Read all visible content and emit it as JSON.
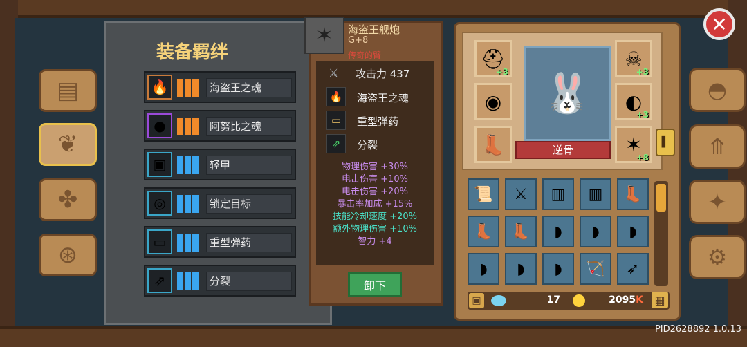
{
  "bonds": {
    "title": "装备羁绊",
    "rows": [
      {
        "name": "海盗王之魂",
        "icon": "flame-icon",
        "frame_color": "#c87a3a",
        "bar_color": "#f08a2a",
        "icon_char": "🔥"
      },
      {
        "name": "阿努比之魂",
        "icon": "fire-orb-icon",
        "frame_color": "#9a4ad8",
        "bar_color": "#f08a2a",
        "icon_char": "●"
      },
      {
        "name": "轻甲",
        "icon": "armor-icon",
        "frame_color": "#3aa6c8",
        "bar_color": "#3aa6f0",
        "icon_char": "▣"
      },
      {
        "name": "锁定目标",
        "icon": "target-icon",
        "frame_color": "#3aa6c8",
        "bar_color": "#3aa6f0",
        "icon_char": "◎"
      },
      {
        "name": "重型弹药",
        "icon": "ammo-icon",
        "frame_color": "#3aa6c8",
        "bar_color": "#3aa6f0",
        "icon_char": "▭"
      },
      {
        "name": "分裂",
        "icon": "split-arrows-icon",
        "frame_color": "#3aa6c8",
        "bar_color": "#3aa6f0",
        "icon_char": "⇗"
      }
    ]
  },
  "item": {
    "name": "海盗王舰炮",
    "level": "G+8",
    "quality": "传奇的臂",
    "attack": "攻击力 437",
    "skills": [
      {
        "icon": "flame-icon",
        "label": "海盗王之魂",
        "icon_char": "🔥",
        "color": "#e04a3a"
      },
      {
        "icon": "ammo-icon",
        "label": "重型弹药",
        "icon_char": "▭",
        "color": "#d8b060"
      },
      {
        "icon": "split-arrows-icon",
        "label": "分裂",
        "icon_char": "⇗",
        "color": "#4ad06a"
      }
    ],
    "stats": [
      {
        "text": "物理伤害 +30%",
        "color": "#c58ae8"
      },
      {
        "text": "电击伤害 +10%",
        "color": "#c58ae8"
      },
      {
        "text": "电击伤害 +20%",
        "color": "#c58ae8"
      },
      {
        "text": "暴击率加成 +15%",
        "color": "#c58ae8"
      },
      {
        "text": "技能冷却速度 +20%",
        "color": "#4ae0c8"
      },
      {
        "text": "额外物理伤害 +10%",
        "color": "#4ae0c8"
      },
      {
        "text": "智力 +4",
        "color": "#c58ae8"
      }
    ],
    "unequip_label": "卸下"
  },
  "character": {
    "name": "逆骨",
    "equip_slots": [
      {
        "name": "helmet-slot",
        "plus": "+3",
        "icon_char": "⛑"
      },
      {
        "name": "ring-slot",
        "plus": "",
        "icon_char": "◉"
      },
      {
        "name": "boots-slot",
        "plus": "",
        "icon_char": "👢"
      },
      {
        "name": "skull-slot",
        "plus": "+3",
        "icon_char": "☠"
      },
      {
        "name": "shoulder-slot",
        "plus": "+3",
        "icon_char": "◐"
      },
      {
        "name": "cannon-slot",
        "plus": "+8",
        "icon_char": "✶"
      }
    ]
  },
  "inventory": {
    "items": [
      "📜",
      "⚔",
      "▥",
      "▥",
      "👢",
      "👢",
      "👢",
      "◗",
      "◗",
      "◗",
      "◗",
      "◗",
      "◗",
      "🏹",
      "➶"
    ],
    "gems": "17",
    "gold": "2095",
    "gold_suffix": "K"
  },
  "footer": {
    "pid": "PID2628892 1.0.13"
  },
  "colors": {
    "accent": "#f5d27a",
    "green_button": "#3fa35a",
    "close_red": "#d23a3a"
  }
}
